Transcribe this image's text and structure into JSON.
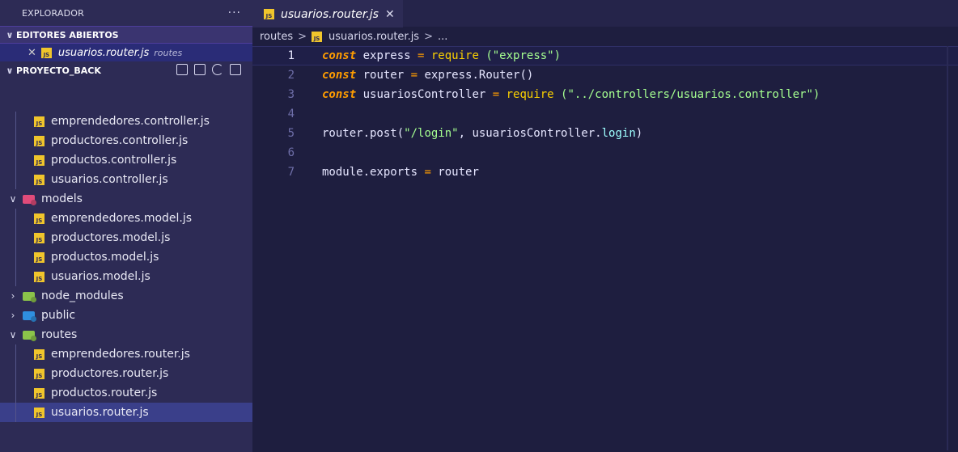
{
  "sidebar": {
    "title": "EXPLORADOR",
    "more": "···",
    "open_editors": {
      "label": "EDITORES ABIERTOS",
      "file": {
        "close": "✕",
        "name": "usuarios.router.js",
        "desc": "routes"
      }
    },
    "project": {
      "label": "PROYECTO_BACK"
    },
    "tree": [
      {
        "kind": "file",
        "label": "emprendedores.controller.js"
      },
      {
        "kind": "file",
        "label": "productores.controller.js"
      },
      {
        "kind": "file",
        "label": "productos.controller.js"
      },
      {
        "kind": "file",
        "label": "usuarios.controller.js"
      },
      {
        "kind": "folder",
        "label": "models",
        "open": true
      },
      {
        "kind": "file",
        "label": "emprendedores.model.js"
      },
      {
        "kind": "file",
        "label": "productores.model.js"
      },
      {
        "kind": "file",
        "label": "productos.model.js"
      },
      {
        "kind": "file",
        "label": "usuarios.model.js"
      },
      {
        "kind": "folder",
        "label": "node_modules",
        "open": false
      },
      {
        "kind": "folder",
        "label": "public",
        "open": false
      },
      {
        "kind": "folder",
        "label": "routes",
        "open": true
      },
      {
        "kind": "file",
        "label": "emprendedores.router.js"
      },
      {
        "kind": "file",
        "label": "productores.router.js"
      },
      {
        "kind": "file",
        "label": "productos.router.js"
      },
      {
        "kind": "file",
        "label": "usuarios.router.js"
      }
    ]
  },
  "editor": {
    "tab": {
      "name": "usuarios.router.js",
      "close": "✕"
    },
    "breadcrumbs": {
      "folder": "routes",
      "sep": ">",
      "file": "usuarios.router.js",
      "tail": "..."
    },
    "lines": [
      {
        "num": "1"
      },
      {
        "num": "2"
      },
      {
        "num": "3"
      },
      {
        "num": "4"
      },
      {
        "num": "5"
      },
      {
        "num": "6"
      },
      {
        "num": "7"
      }
    ],
    "code": {
      "l1": {
        "kw": "const",
        "rest1": " express ",
        "op": "=",
        "fn": " require",
        "str": " (\"express\")"
      },
      "l2": {
        "kw": "const",
        "rest1": " router ",
        "op": "=",
        "rest2": " express.Router()"
      },
      "l3": {
        "kw": "const",
        "rest1": " usuariosController ",
        "op": "=",
        "fn": " require",
        "str": " (\"../controllers/usuarios.controller\")"
      },
      "l5": {
        "a": "router.post(",
        "str": "\"/login\"",
        "b": ", usuariosController.",
        "prop": "login",
        "c": ")"
      },
      "l7": {
        "a": "module.exports ",
        "op": "=",
        "b": " router"
      }
    }
  },
  "icon_text": "JS"
}
